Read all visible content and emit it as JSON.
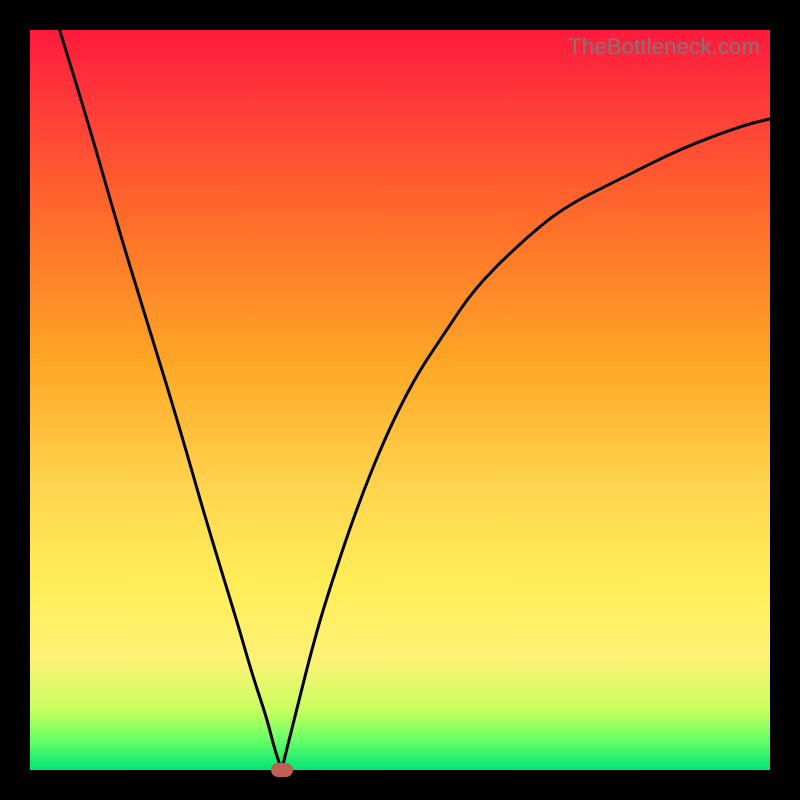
{
  "watermark": "TheBottleneck.com",
  "chart_data": {
    "type": "line",
    "title": "",
    "xlabel": "",
    "ylabel": "",
    "xlim": [
      0,
      100
    ],
    "ylim": [
      0,
      100
    ],
    "grid": false,
    "legend": false,
    "annotations": [],
    "series": [
      {
        "name": "left-branch",
        "x": [
          4,
          8,
          12,
          16,
          20,
          24,
          28,
          30,
          32,
          33,
          34
        ],
        "y": [
          100,
          87,
          73,
          60,
          47,
          33,
          20,
          13,
          7,
          3,
          0
        ]
      },
      {
        "name": "right-branch",
        "x": [
          34,
          36,
          38,
          40,
          44,
          48,
          52,
          56,
          60,
          66,
          72,
          80,
          88,
          96,
          100
        ],
        "y": [
          0,
          8,
          16,
          23,
          35,
          45,
          53,
          59,
          65,
          71,
          76,
          80,
          84,
          87,
          88
        ]
      }
    ],
    "marker": {
      "x": 34,
      "y": 0,
      "color": "#c06055"
    },
    "background_gradient": {
      "top": "#ff1a3c",
      "bottom": "#00e676"
    }
  }
}
